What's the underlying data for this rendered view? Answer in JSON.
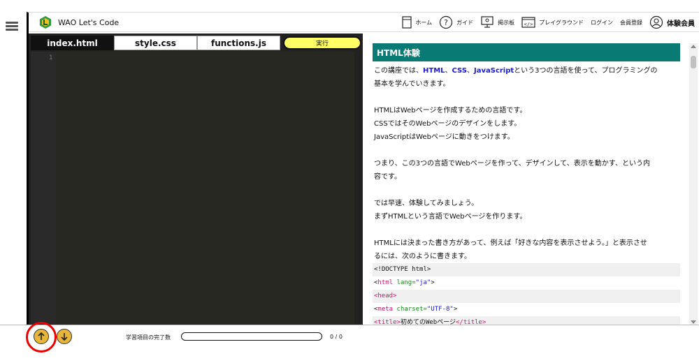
{
  "brand": {
    "title": "WAO Let's Code"
  },
  "nav": {
    "home": "ホーム",
    "guide": "ガイド",
    "board": "掲示板",
    "playground": "プレイグラウンド",
    "login": "ログイン",
    "register": "会員登録",
    "trial_member": "体験会員"
  },
  "editor": {
    "tabs": [
      "index.html",
      "style.css",
      "functions.js"
    ],
    "active_tab": "index.html",
    "run_label": "実行",
    "line_number": "1"
  },
  "content": {
    "title": "HTML体験",
    "intro_prefix": "この講座では、",
    "kw_html": "HTML",
    "sep1": "、",
    "kw_css": "CSS",
    "sep2": "、",
    "kw_js": "JavaScript",
    "intro_suffix": "という3つの言語を使って、プログラミングの",
    "intro_line2": "基本を学んでいきます。",
    "p2_l1": "HTMLはWebページを作成するための言語です。",
    "p2_l2": "CSSではそのWebページのデザインをします。",
    "p2_l3": "JavaScriptはWebページに動きをつけます。",
    "p3_l1": "つまり、この3つの言語でWebページを作って、デザインして、表示を動かす、という内",
    "p3_l2": "容です。",
    "p4_l1": "では早速、体験してみましょう。",
    "p4_l2": "まずHTMLという言語でWebページを作ります。",
    "p5_l1": "HTMLには決まった書き方があって、例えば「好きな内容を表示させよう。」と表示させ",
    "p5_l2": "るには、次のように書きます。",
    "code": {
      "l1": "<!DOCTYPE html>",
      "l2_open": "<",
      "l2_tag": "html",
      "l2_attr": " lang=",
      "l2_val": "\"ja\"",
      "l2_close": ">",
      "l3_tag": "<head>",
      "l4_tag_open": "<",
      "l4_tag": "meta",
      "l4_attr": " charset=",
      "l4_val": "\"UTF-8\"",
      "l4_close": ">",
      "l5_open": "<title>",
      "l5_text": "初めてのWebページ",
      "l5_close": "</title>"
    }
  },
  "bottom": {
    "progress_label": "学習項目の完了数",
    "progress_count": "0 / 0",
    "progress_fraction": 0
  },
  "colors": {
    "accent_teal": "#0a7b74",
    "run_yellow": "#ffff66",
    "arrow_gold": "#e6b53a",
    "highlight_red": "#ee0000"
  },
  "icons": {
    "menu": "hamburger-icon",
    "home": "home-icon",
    "guide": "question-icon",
    "board": "monitor-icon",
    "playground": "code-icon",
    "avatar": "user-icon",
    "up": "arrow-up-icon",
    "down": "arrow-down-icon"
  }
}
